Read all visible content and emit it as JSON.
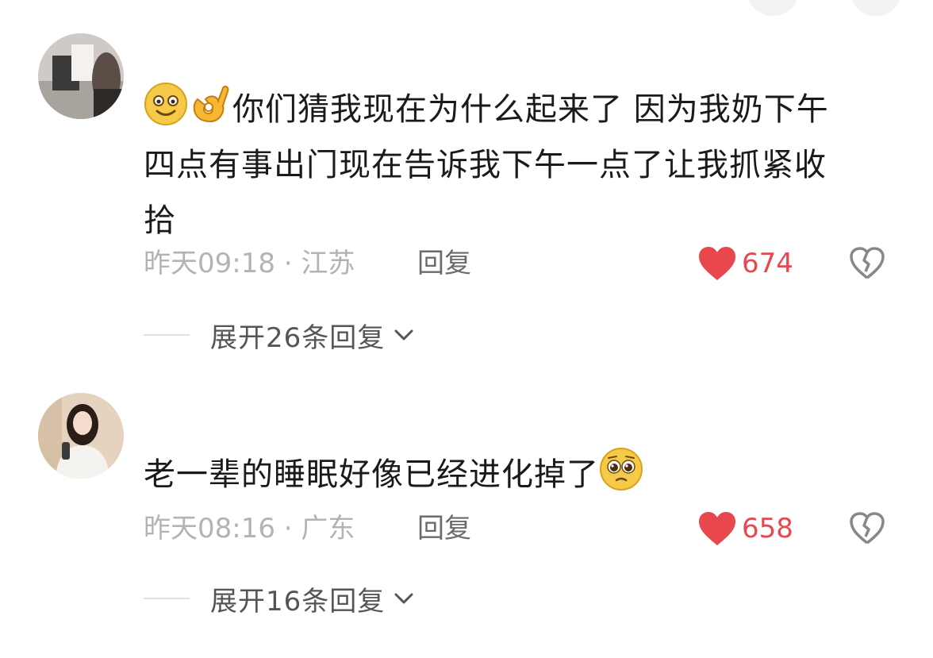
{
  "comments": [
    {
      "avatar": "avatar-room-photo",
      "text_emojis": [
        "smiling-face-emoji",
        "ok-hand-emoji"
      ],
      "text_line1": "你们猜我现在为什么起来了 因为我奶下午",
      "text_line2": "四点有事出门现在告诉我下午一点了让我抓紧收",
      "text_line3": "拾",
      "time": "昨天09:18 · 江苏",
      "reply_label": "回复",
      "like_count": "674",
      "expand_label": "展开26条回复"
    },
    {
      "avatar": "avatar-selfie-photo",
      "text_line1": "老一辈的睡眠好像已经进化掉了",
      "text_emoji_after": "pleading-face-emoji",
      "time": "昨天08:16 · 广东",
      "reply_label": "回复",
      "like_count": "658",
      "expand_label": "展开16条回复"
    }
  ],
  "icons": {
    "like": "heart-icon",
    "dislike": "broken-heart-icon",
    "expand": "chevron-down-icon"
  },
  "colors": {
    "like": "#e8474d",
    "meta_text": "#b3b3b3",
    "reply_text": "#6b6b6b",
    "body_text": "#1a1a1a"
  }
}
